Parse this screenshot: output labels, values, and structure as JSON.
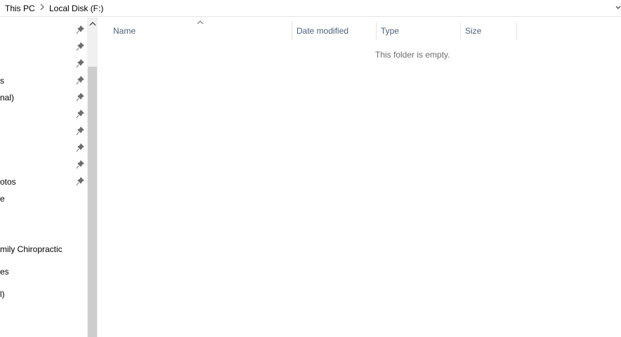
{
  "breadcrumb": {
    "items": [
      "This PC",
      "Local Disk (F:)"
    ]
  },
  "navigation": {
    "items": [
      {
        "label": "",
        "pinned": true
      },
      {
        "label": "",
        "pinned": true
      },
      {
        "label": "",
        "pinned": true
      },
      {
        "label": "s",
        "pinned": true
      },
      {
        "label": "nal)",
        "pinned": true
      },
      {
        "label": "",
        "pinned": true
      },
      {
        "label": "",
        "pinned": true
      },
      {
        "label": "",
        "pinned": true
      },
      {
        "label": "",
        "pinned": true
      },
      {
        "label": "otos",
        "pinned": true
      },
      {
        "label": "e",
        "pinned": false
      },
      {
        "label": "mily Chiropractic",
        "pinned": false
      },
      {
        "label": "es",
        "pinned": false
      },
      {
        "label": "l)",
        "pinned": false
      }
    ]
  },
  "columns": {
    "name": "Name",
    "date_modified": "Date modified",
    "type": "Type",
    "size": "Size"
  },
  "sort": {
    "column": "Name",
    "direction": "ascending"
  },
  "content": {
    "empty_message": "This folder is empty."
  },
  "icons": {
    "breadcrumb_separator": "chevron-right-icon",
    "pin": "pin-icon",
    "sort": "sort-ascending-icon",
    "scroll_up": "scroll-up-icon",
    "address_dropdown": "chevron-down-icon"
  }
}
